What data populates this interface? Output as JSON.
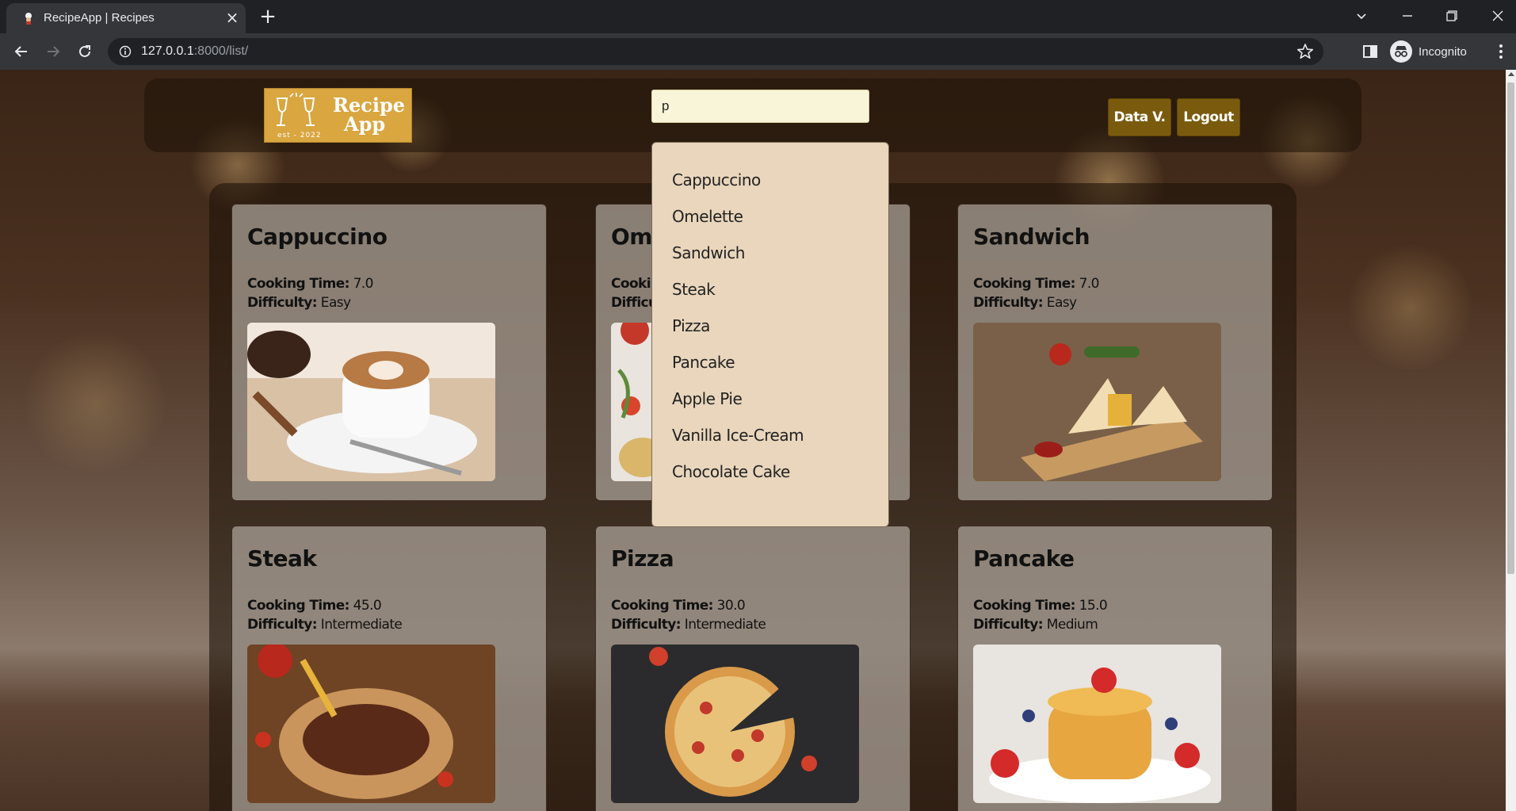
{
  "browser": {
    "tab_title": "RecipeApp | Recipes",
    "url_host": "127.0.0.1",
    "url_rest": ":8000/list/",
    "profile_label": "Incognito"
  },
  "header": {
    "logo_line1": "Recipe",
    "logo_line2": "App",
    "logo_est": "est - 2022",
    "search_value": "p",
    "data_button": "Data V.",
    "logout_button": "Logout"
  },
  "dropdown": {
    "items": [
      "Cappuccino",
      "Omelette",
      "Sandwich",
      "Steak",
      "Pizza",
      "Pancake",
      "Apple Pie",
      "Vanilla Ice-Cream",
      "Chocolate Cake"
    ]
  },
  "labels": {
    "cooking_time": "Cooking Time:",
    "difficulty": "Difficulty:"
  },
  "recipes": [
    {
      "name": "Cappuccino",
      "cooking_time": "7.0",
      "difficulty": "Easy"
    },
    {
      "name": "Omelette",
      "cooking_time": "",
      "difficulty": ""
    },
    {
      "name": "Sandwich",
      "cooking_time": "7.0",
      "difficulty": "Easy"
    },
    {
      "name": "Steak",
      "cooking_time": "45.0",
      "difficulty": "Intermediate"
    },
    {
      "name": "Pizza",
      "cooking_time": "30.0",
      "difficulty": "Intermediate"
    },
    {
      "name": "Pancake",
      "cooking_time": "15.0",
      "difficulty": "Medium"
    }
  ],
  "colors": {
    "header_button": "#7a5b0e",
    "search_bg": "#f8f5d8",
    "dropdown_bg": "#e9d6bc",
    "logo_bg": "#d9a640"
  }
}
